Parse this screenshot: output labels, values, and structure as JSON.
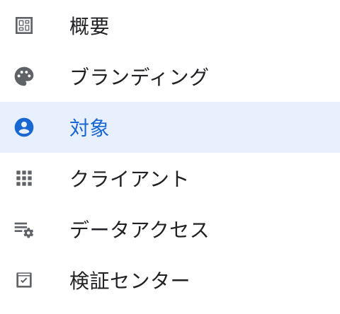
{
  "nav": {
    "items": [
      {
        "label": "概要",
        "icon": "dashboard-icon",
        "active": false
      },
      {
        "label": "ブランディング",
        "icon": "palette-icon",
        "active": false
      },
      {
        "label": "対象",
        "icon": "account-circle-icon",
        "active": true
      },
      {
        "label": "クライアント",
        "icon": "apps-grid-icon",
        "active": false
      },
      {
        "label": "データアクセス",
        "icon": "list-settings-icon",
        "active": false
      },
      {
        "label": "検証センター",
        "icon": "check-box-icon",
        "active": false
      }
    ]
  },
  "colors": {
    "icon": "#5f6368",
    "active_icon": "#1967d2",
    "active_background": "#e8f0fe",
    "text": "#202124",
    "active_text": "#1967d2"
  }
}
